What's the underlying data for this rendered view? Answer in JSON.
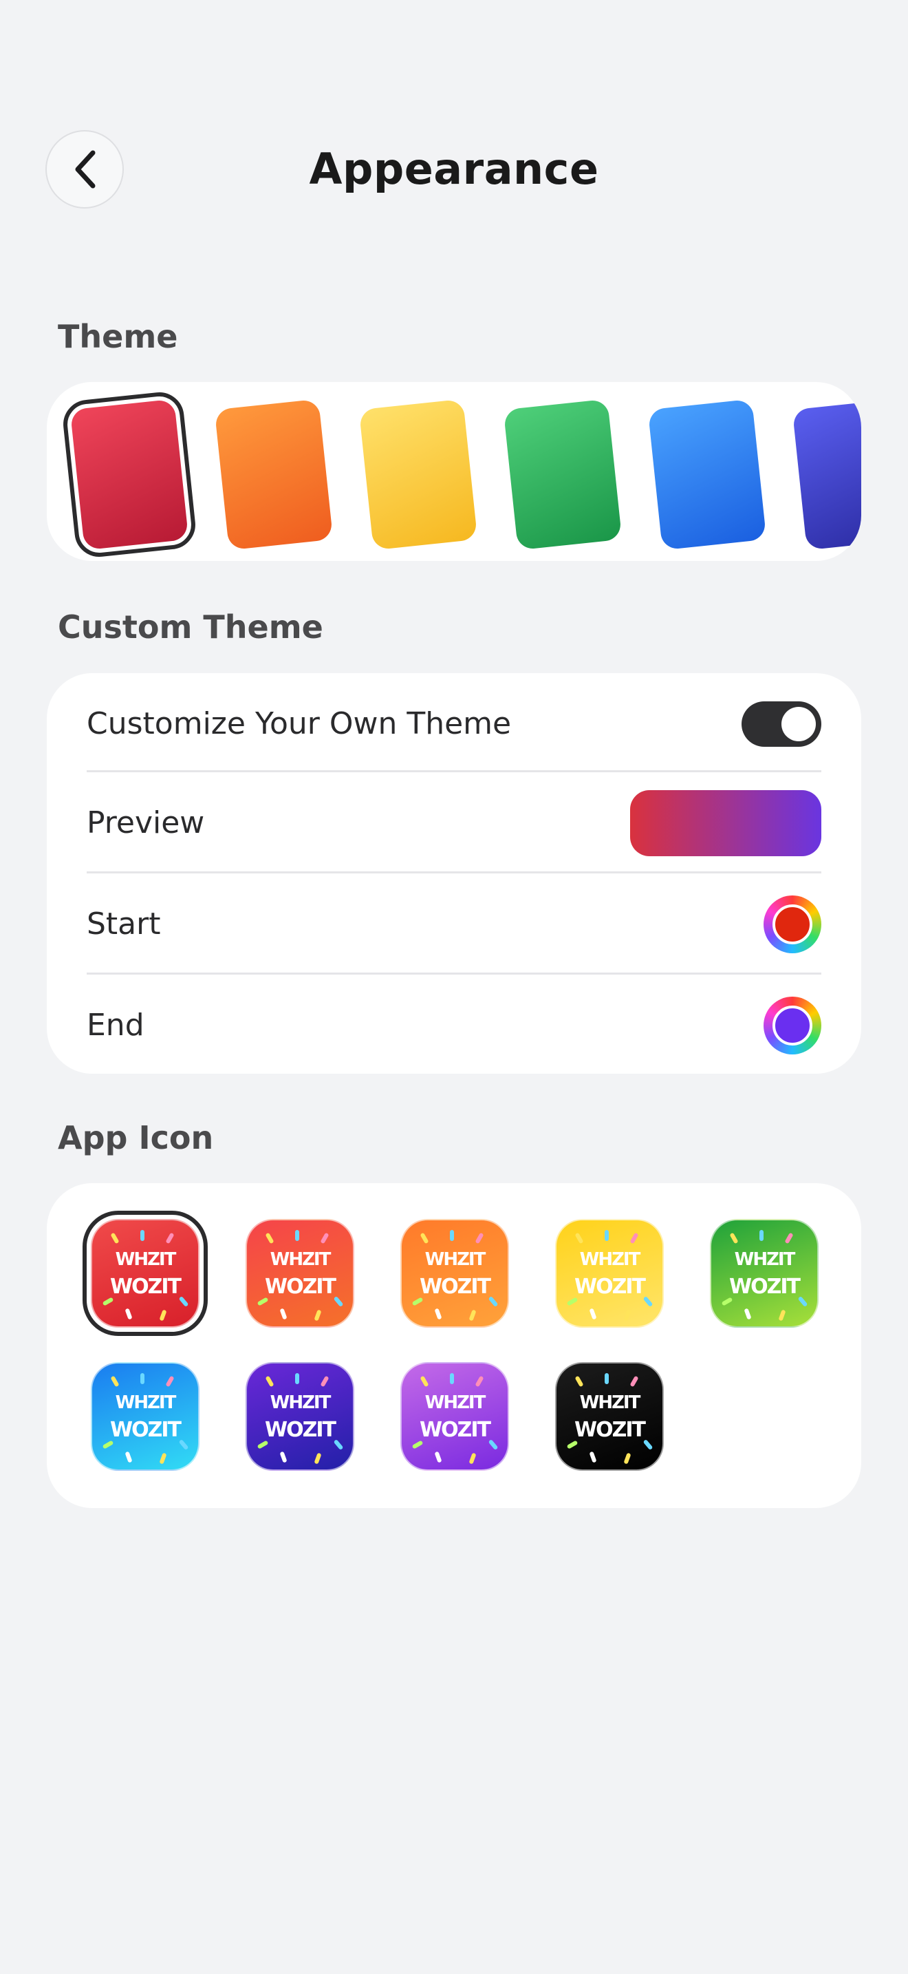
{
  "header": {
    "title": "Appearance",
    "back_icon": "chevron-left-icon"
  },
  "sections": {
    "theme": "Theme",
    "custom_theme": "Custom Theme",
    "app_icon": "App Icon"
  },
  "themes": [
    {
      "name": "red",
      "from": "#f0455a",
      "to": "#b71a34",
      "selected": true
    },
    {
      "name": "orange",
      "from": "#ff9a3d",
      "to": "#ef5d1f"
    },
    {
      "name": "yellow",
      "from": "#ffe16b",
      "to": "#f6b820"
    },
    {
      "name": "green",
      "from": "#4fd07a",
      "to": "#1a9648"
    },
    {
      "name": "blue",
      "from": "#4aa3ff",
      "to": "#1a5fe0"
    },
    {
      "name": "indigo",
      "from": "#5a5ff0",
      "to": "#2a2aa0"
    }
  ],
  "custom_theme": {
    "customize_label": "Customize Your Own Theme",
    "customize_on": true,
    "preview_label": "Preview",
    "preview_from": "#d9323e",
    "preview_to": "#6a35e0",
    "start_label": "Start",
    "start_color": "#e0270e",
    "end_label": "End",
    "end_color": "#6a2ff0"
  },
  "app_icons": {
    "wordmark_top": "WHZIT",
    "wordmark_bottom": "WOZIT",
    "items": [
      {
        "name": "red",
        "from": "#f04a4a",
        "to": "#d8202a",
        "selected": true
      },
      {
        "name": "red-orange",
        "from": "#f5444a",
        "to": "#f5712a"
      },
      {
        "name": "orange",
        "from": "#ff7a2a",
        "to": "#ffa23a"
      },
      {
        "name": "yellow",
        "from": "#ffd21a",
        "to": "#ffe56a"
      },
      {
        "name": "green",
        "from": "#1fa23a",
        "to": "#a8e03a"
      },
      {
        "name": "sky",
        "from": "#1a7cf0",
        "to": "#32dcf5"
      },
      {
        "name": "indigo",
        "from": "#6a28d8",
        "to": "#2320a8"
      },
      {
        "name": "purple",
        "from": "#c46ae8",
        "to": "#7a2ae0"
      },
      {
        "name": "black",
        "from": "#1c1c1c",
        "to": "#000000"
      }
    ]
  }
}
